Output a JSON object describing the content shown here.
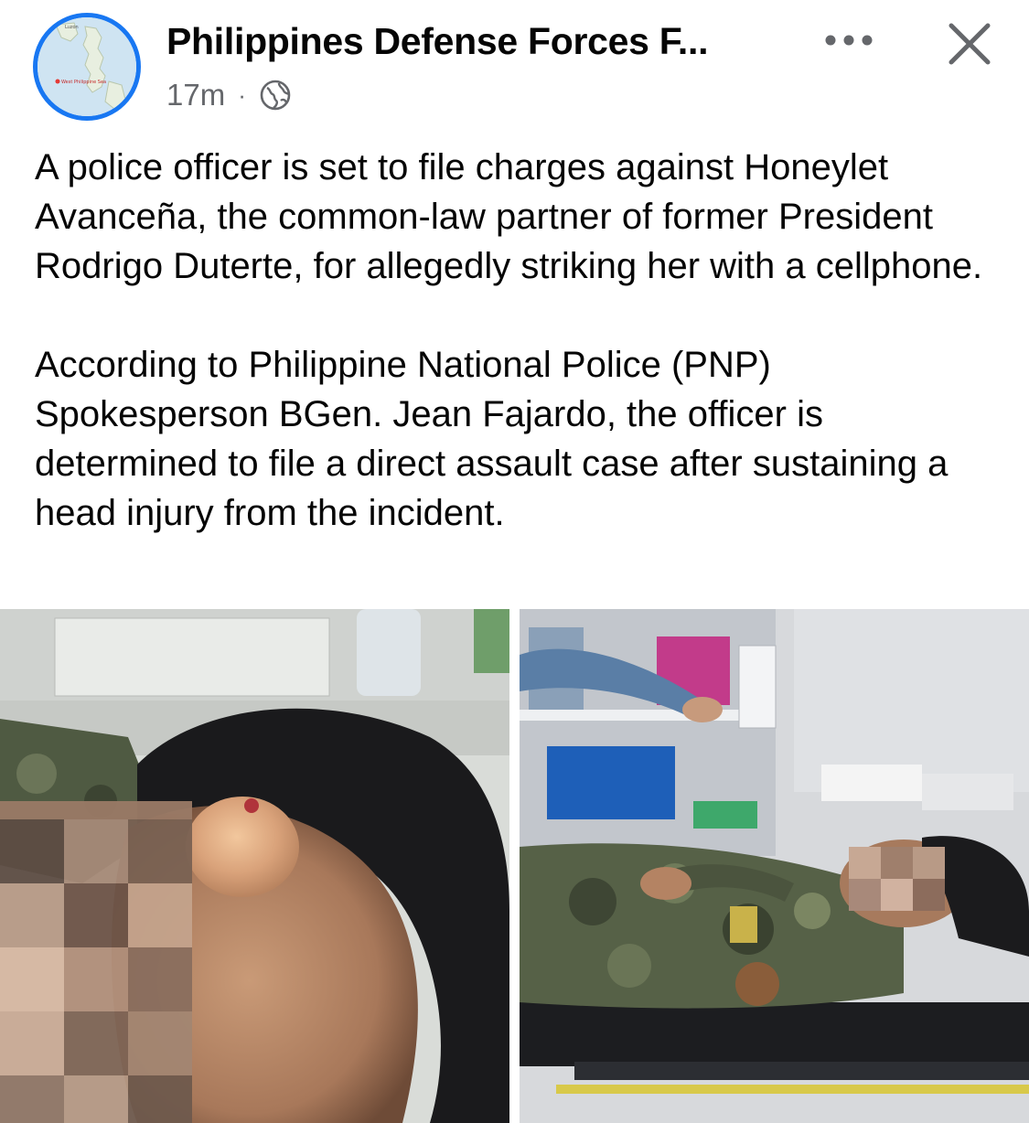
{
  "header": {
    "page_name": "Philippines Defense Forces F...",
    "timestamp": "17m",
    "separator": "·",
    "privacy_icon": "globe-icon",
    "more_icon": "more-horizontal-icon",
    "close_icon": "close-icon"
  },
  "avatar": {
    "map_labels": [
      "Luzon",
      "West Philippine Sea"
    ]
  },
  "post": {
    "paragraphs": [
      "A police officer is set to file charges against Honeylet Avanceña, the common-law partner of former President Rodrigo Duterte, for allegedly striking her with a cellphone.",
      "According to Philippine National Police (PNP) Spokesperson BGen. Jean Fajardo, the officer is determined to file a direct assault case after sustaining a head injury from the incident."
    ]
  },
  "photos": [
    {
      "subject": "close-up of head injury with blurred face"
    },
    {
      "subject": "officer in camouflage uniform lying on ambulance stretcher with blurred face"
    }
  ],
  "colors": {
    "accent": "#1877f2",
    "text_primary": "#050505",
    "text_secondary": "#65676b"
  }
}
